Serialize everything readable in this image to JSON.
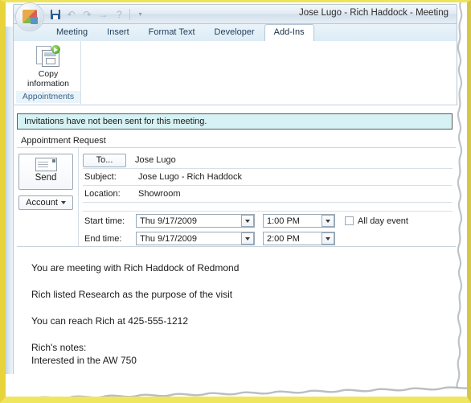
{
  "window": {
    "title": "Jose Lugo - Rich Haddock - Meeting",
    "orb_name": "office-button"
  },
  "quick_access": {
    "items": [
      {
        "name": "save-icon",
        "glyph": ""
      },
      {
        "name": "undo-icon",
        "glyph": "↶"
      },
      {
        "name": "redo-icon",
        "glyph": "↷"
      },
      {
        "name": "forward-icon",
        "glyph": "→"
      },
      {
        "name": "help-icon",
        "glyph": "?"
      },
      {
        "name": "customize-qat-icon",
        "glyph": "▾"
      }
    ]
  },
  "ribbon": {
    "tabs": [
      {
        "label": "Meeting",
        "active": false
      },
      {
        "label": "Insert",
        "active": false
      },
      {
        "label": "Format Text",
        "active": false
      },
      {
        "label": "Developer",
        "active": false
      },
      {
        "label": "Add-Ins",
        "active": true
      }
    ],
    "group": {
      "title": "Appointments",
      "button_line1": "Copy",
      "button_line2": "information"
    }
  },
  "infobar": {
    "message": "Invitations have not been sent for this meeting."
  },
  "form": {
    "header": "Appointment Request",
    "send_label": "Send",
    "account_label": "Account",
    "to_button": "To...",
    "to_value": "Jose Lugo",
    "subject_label": "Subject:",
    "subject_value": "Jose Lugo - Rich Haddock",
    "location_label": "Location:",
    "location_value": "Showroom",
    "start_label": "Start time:",
    "start_date": "Thu 9/17/2009",
    "start_time": "1:00 PM",
    "end_label": "End time:",
    "end_date": "Thu 9/17/2009",
    "end_time": "2:00 PM",
    "all_day_label": "All day event",
    "all_day_checked": false
  },
  "body": {
    "lines": [
      "You are meeting with Rich Haddock of Redmond",
      "Rich listed Research as the purpose of the visit",
      "You can reach Rich at 425-555-1212",
      "Rich's notes:",
      "Interested in the AW 750"
    ]
  },
  "colors": {
    "frame": "#e8d33a",
    "infobar_bg": "#d6f2f4",
    "tab_text": "#1f3d5c",
    "group_title": "#3a6287"
  }
}
